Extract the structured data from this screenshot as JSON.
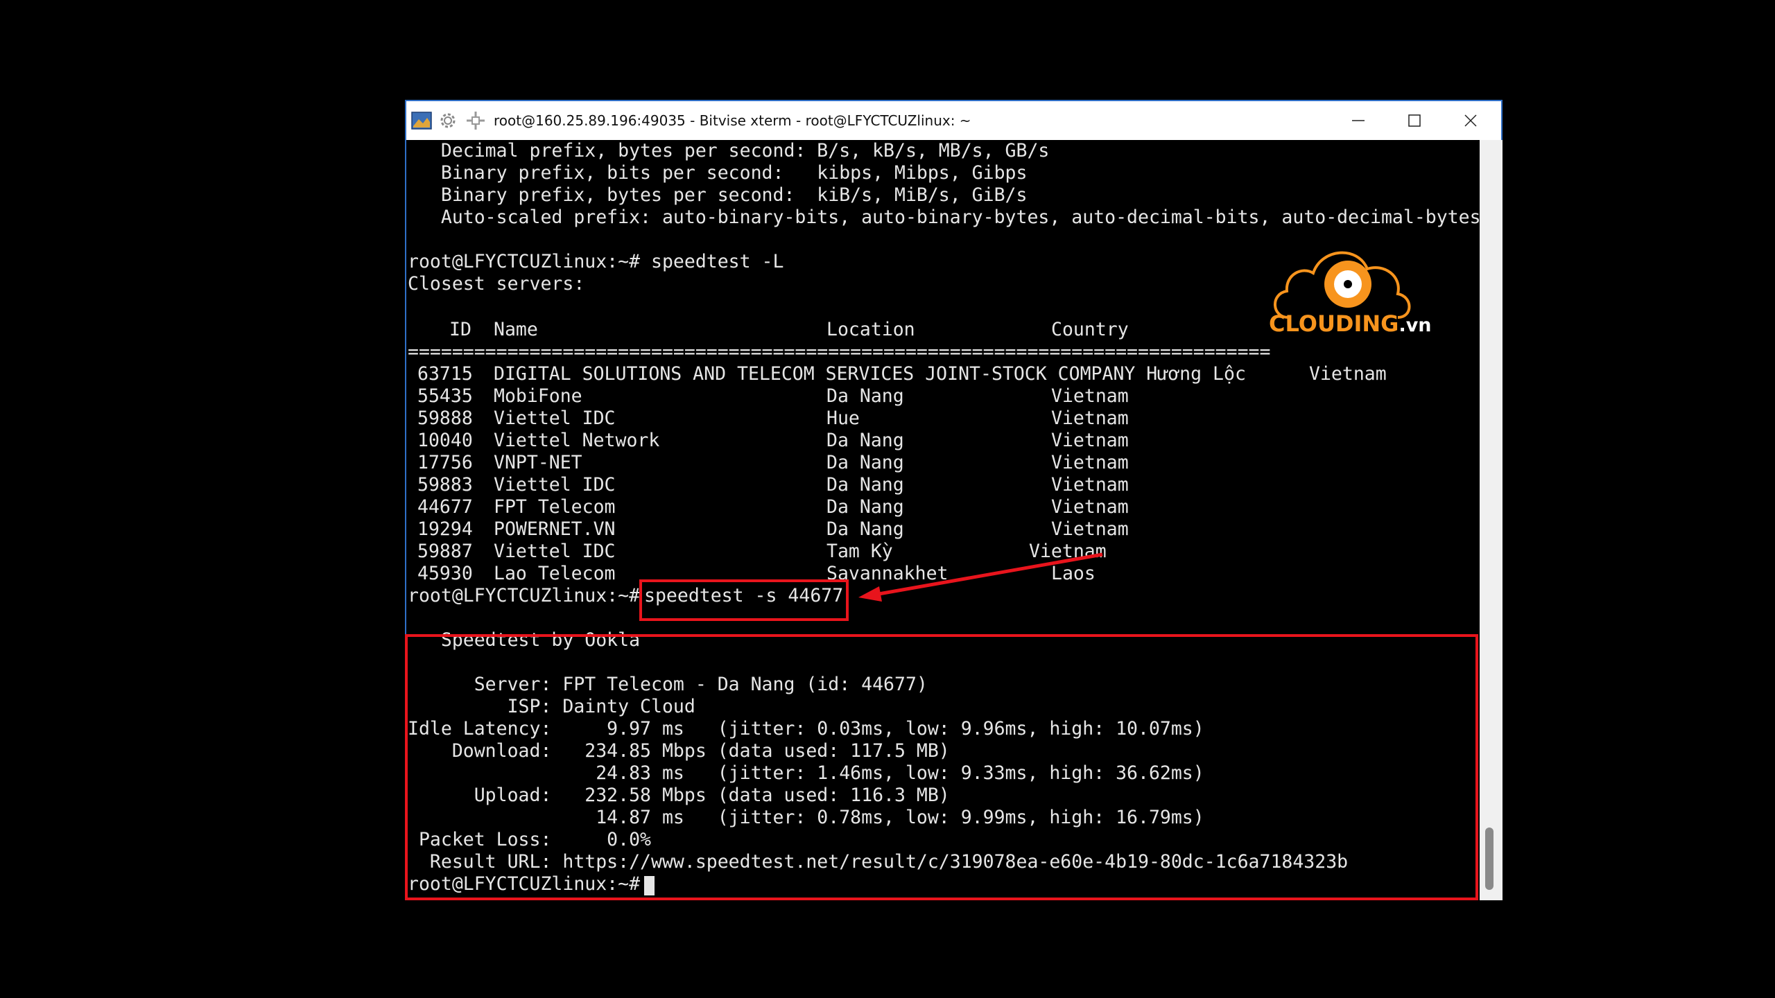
{
  "window": {
    "title": "root@160.25.89.196:49035 - Bitvise xterm - root@LFYCTCUZlinux: ~",
    "icons": [
      "app-icon",
      "settings-icon",
      "new-terminal-icon"
    ],
    "controls": [
      "minimize-icon",
      "maximize-icon",
      "close-icon"
    ]
  },
  "terminal": {
    "pre_lines": [
      "   Decimal prefix, bytes per second: B/s, kB/s, MB/s, GB/s",
      "   Binary prefix, bits per second:   kibps, Mibps, Gibps",
      "   Binary prefix, bytes per second:  kiB/s, MiB/s, GiB/s",
      "   Auto-scaled prefix: auto-binary-bits, auto-binary-bytes, auto-decimal-bits, auto-decimal-bytes",
      "",
      "root@LFYCTCUZlinux:~# speedtest -L",
      "Closest servers:"
    ],
    "table_headers": {
      "id": "ID",
      "name": "Name",
      "location": "Location",
      "country": "Country"
    },
    "separator": "==============================================================================",
    "servers": [
      {
        "id": "63715",
        "name": "DIGITAL SOLUTIONS AND TELECOM SERVICES JOINT-STOCK COMPANY Hương Lộc",
        "location": "",
        "country": "Vietnam"
      },
      {
        "id": "55435",
        "name": "MobiFone",
        "location": "Da Nang",
        "country": "Vietnam"
      },
      {
        "id": "59888",
        "name": "Viettel IDC",
        "location": "Hue",
        "country": "Vietnam"
      },
      {
        "id": "10040",
        "name": "Viettel Network",
        "location": "Da Nang",
        "country": "Vietnam"
      },
      {
        "id": "17756",
        "name": "VNPT-NET",
        "location": "Da Nang",
        "country": "Vietnam"
      },
      {
        "id": "59883",
        "name": "Viettel IDC",
        "location": "Da Nang",
        "country": "Vietnam"
      },
      {
        "id": "44677",
        "name": "FPT Telecom",
        "location": "Da Nang",
        "country": "Vietnam"
      },
      {
        "id": "19294",
        "name": "POWERNET.VN",
        "location": "Da Nang",
        "country": "Vietnam"
      },
      {
        "id": "59887",
        "name": "Viettel IDC",
        "location": "Tam Kỳ",
        "country": "Vietnam"
      },
      {
        "id": "45930",
        "name": "Lao Telecom",
        "location": "Savannakhet",
        "country": "Laos"
      }
    ],
    "prompt": "root@LFYCTCUZlinux:~# ",
    "command": "speedtest -s 44677",
    "result_lines": [
      "   Speedtest by Ookla",
      "",
      "      Server: FPT Telecom - Da Nang (id: 44677)",
      "         ISP: Dainty Cloud",
      "Idle Latency:     9.97 ms   (jitter: 0.03ms, low: 9.96ms, high: 10.07ms)",
      "    Download:   234.85 Mbps (data used: 117.5 MB)",
      "                 24.83 ms   (jitter: 1.46ms, low: 9.33ms, high: 36.62ms)",
      "      Upload:   232.58 Mbps (data used: 116.3 MB)",
      "                 14.87 ms   (jitter: 0.78ms, low: 9.99ms, high: 16.79ms)",
      " Packet Loss:     0.0%",
      "  Result URL: https://www.speedtest.net/result/c/319078ea-e60e-4b19-80dc-1c6a7184323b"
    ],
    "final_prompt": "root@LFYCTCUZlinux:~# "
  },
  "logo": {
    "main": "CLOUDING",
    "suffix": ".vn"
  },
  "colors": {
    "terminal_bg": "#000000",
    "terminal_fg": "#e6e6e6",
    "highlight": "#e8141c",
    "logo_orange": "#f7941d"
  }
}
